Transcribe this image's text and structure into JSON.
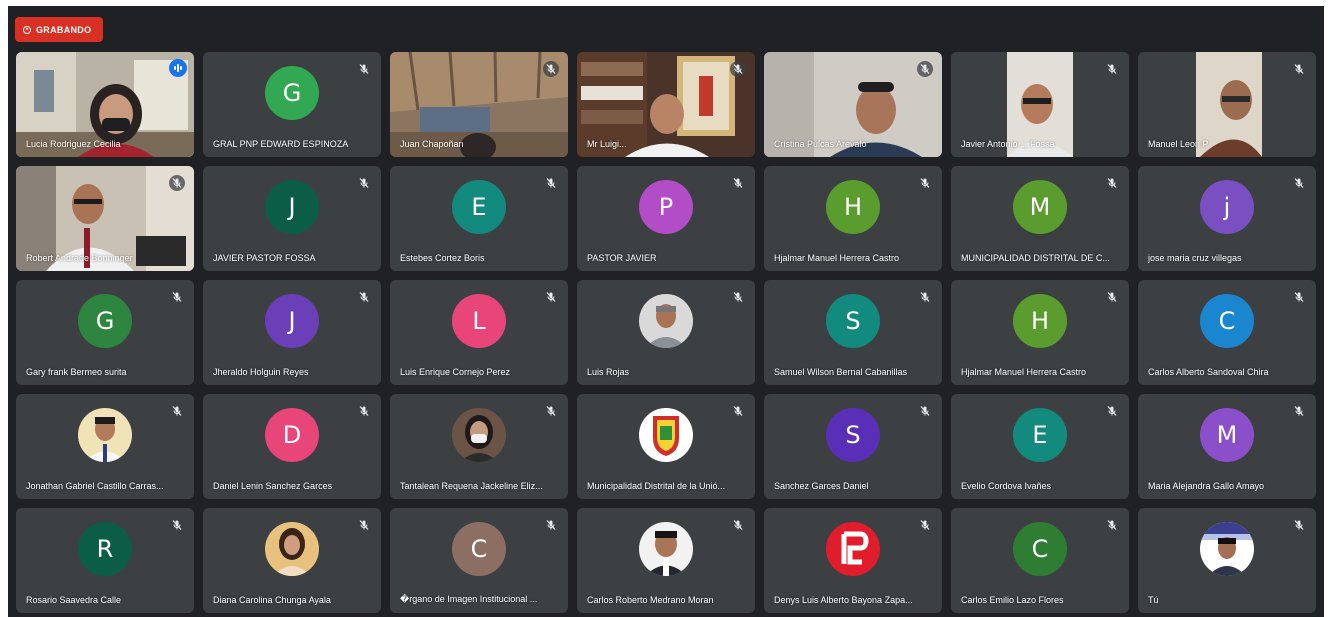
{
  "recording": {
    "label": "GRABANDO"
  },
  "participants": [
    {
      "name": "Lucia Rodriguez Cecilia",
      "type": "video",
      "muted": false,
      "speaking": true
    },
    {
      "name": "GRAL PNP EDWARD ESPINOZA",
      "type": "initial",
      "initial": "G",
      "color": "#33a852",
      "muted": true
    },
    {
      "name": "Juan Chapoñan",
      "type": "video",
      "muted": true
    },
    {
      "name": "Mr Luigi...",
      "type": "video",
      "muted": true
    },
    {
      "name": "Cristina Pulcas Arevalo",
      "type": "video",
      "muted": true
    },
    {
      "name": "Javier Antonio ... Fossa",
      "type": "video",
      "muted": true
    },
    {
      "name": "Manuel Leon P",
      "type": "video",
      "muted": true
    },
    {
      "name": "Robert Andrade Bonninger",
      "type": "video",
      "muted": true
    },
    {
      "name": "JAVIER PASTOR FOSSA",
      "type": "initial",
      "initial": "J",
      "color": "#0b5e45",
      "muted": true
    },
    {
      "name": "Estebes Cortez Boris",
      "type": "initial",
      "initial": "E",
      "color": "#128a7d",
      "muted": true
    },
    {
      "name": "PASTOR JAVIER",
      "type": "initial",
      "initial": "P",
      "color": "#b24cc7",
      "muted": true
    },
    {
      "name": "Hjalmar Manuel Herrera Castro",
      "type": "initial",
      "initial": "H",
      "color": "#5a9c2e",
      "muted": true
    },
    {
      "name": "MUNICIPALIDAD DISTRITAL DE C...",
      "type": "initial",
      "initial": "M",
      "color": "#5a9c2e",
      "muted": true
    },
    {
      "name": "jose maria cruz villegas",
      "type": "initial",
      "initial": "j",
      "color": "#7a4fc2",
      "muted": true
    },
    {
      "name": "Gary frank Bermeo surita",
      "type": "initial",
      "initial": "G",
      "color": "#2e8540",
      "muted": true
    },
    {
      "name": "Jheraldo Holguin Reyes",
      "type": "initial",
      "initial": "J",
      "color": "#6a3fb8",
      "muted": true
    },
    {
      "name": "Luis Enrique Cornejo Perez",
      "type": "initial",
      "initial": "L",
      "color": "#e8457a",
      "muted": true
    },
    {
      "name": "Luis Rojas",
      "type": "photo",
      "photo": "man-gray",
      "muted": true
    },
    {
      "name": "Samuel Wilson Bernal Cabanillas",
      "type": "initial",
      "initial": "S",
      "color": "#128a7d",
      "muted": true
    },
    {
      "name": "Hjalmar Manuel Herrera Castro",
      "type": "initial",
      "initial": "H",
      "color": "#5a9c2e",
      "muted": true
    },
    {
      "name": "Carlos Alberto Sandoval Chira",
      "type": "initial",
      "initial": "C",
      "color": "#1a86d0",
      "muted": true
    },
    {
      "name": "Jonathan Gabriel Castillo Carras...",
      "type": "photo",
      "photo": "man-tie",
      "muted": true
    },
    {
      "name": "Daniel Lenin Sanchez Garces",
      "type": "initial",
      "initial": "D",
      "color": "#e8457a",
      "muted": true
    },
    {
      "name": "Tantalean Requena Jackeline Eliz...",
      "type": "photo",
      "photo": "woman-mask",
      "muted": true
    },
    {
      "name": "Municipalidad Distrital de la Unió...",
      "type": "photo",
      "photo": "crest",
      "muted": true
    },
    {
      "name": "Sanchez Garces Daniel",
      "type": "initial",
      "initial": "S",
      "color": "#5a2fb8",
      "muted": true
    },
    {
      "name": "Evelio Cordova Ivañes",
      "type": "initial",
      "initial": "E",
      "color": "#128a7d",
      "muted": true
    },
    {
      "name": "Maria Alejandra Gallo Amayo",
      "type": "initial",
      "initial": "M",
      "color": "#8a4fc9",
      "muted": true
    },
    {
      "name": "Rosario Saavedra Calle",
      "type": "initial",
      "initial": "R",
      "color": "#0b5e45",
      "muted": true
    },
    {
      "name": "Diana Carolina Chunga Ayala",
      "type": "photo",
      "photo": "woman-bright",
      "muted": true
    },
    {
      "name": "�rgano de Imagen Institucional ...",
      "type": "initial",
      "initial": "C",
      "color": "#8d6e63",
      "muted": true
    },
    {
      "name": "Carlos Roberto Medrano Moran",
      "type": "photo",
      "photo": "man-suit",
      "muted": true
    },
    {
      "name": "Denys Luis Alberto Bayona Zapa...",
      "type": "photo",
      "photo": "logo-red",
      "muted": true
    },
    {
      "name": "Carlos Emilio Lazo Flores",
      "type": "initial",
      "initial": "C",
      "color": "#2e7d32",
      "muted": true
    },
    {
      "name": "Tú",
      "type": "photo",
      "photo": "man-banner",
      "muted": true
    }
  ]
}
